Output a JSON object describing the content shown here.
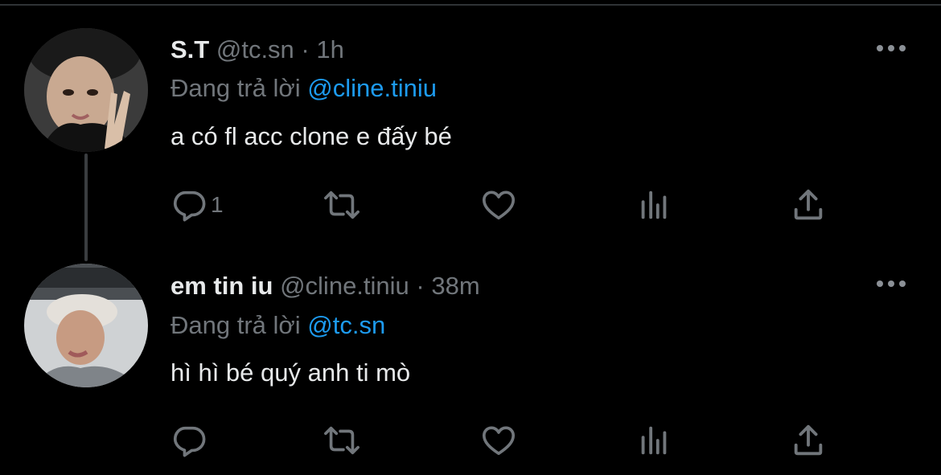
{
  "tweets": [
    {
      "name": "S.T",
      "handle": "@tc.sn",
      "separator": "·",
      "time": "1h",
      "replying_prefix": "Đang trả lời",
      "replying_to": "@cline.tiniu",
      "text": "a có fl acc clone e đấy bé",
      "reply_count": "1"
    },
    {
      "name": "em tin iu",
      "handle": "@cline.tiniu",
      "separator": "·",
      "time": "38m",
      "replying_prefix": "Đang trả lời",
      "replying_to": "@tc.sn",
      "text": "hì hì bé quý anh ti mò",
      "reply_count": ""
    }
  ],
  "icons": {
    "more": "more-dots-icon",
    "reply": "reply-icon",
    "retweet": "retweet-icon",
    "like": "heart-icon",
    "analytics": "analytics-icon",
    "share": "share-icon"
  },
  "colors": {
    "background": "#000000",
    "text": "#e7e9ea",
    "muted": "#71767b",
    "link": "#1d9bf0"
  }
}
